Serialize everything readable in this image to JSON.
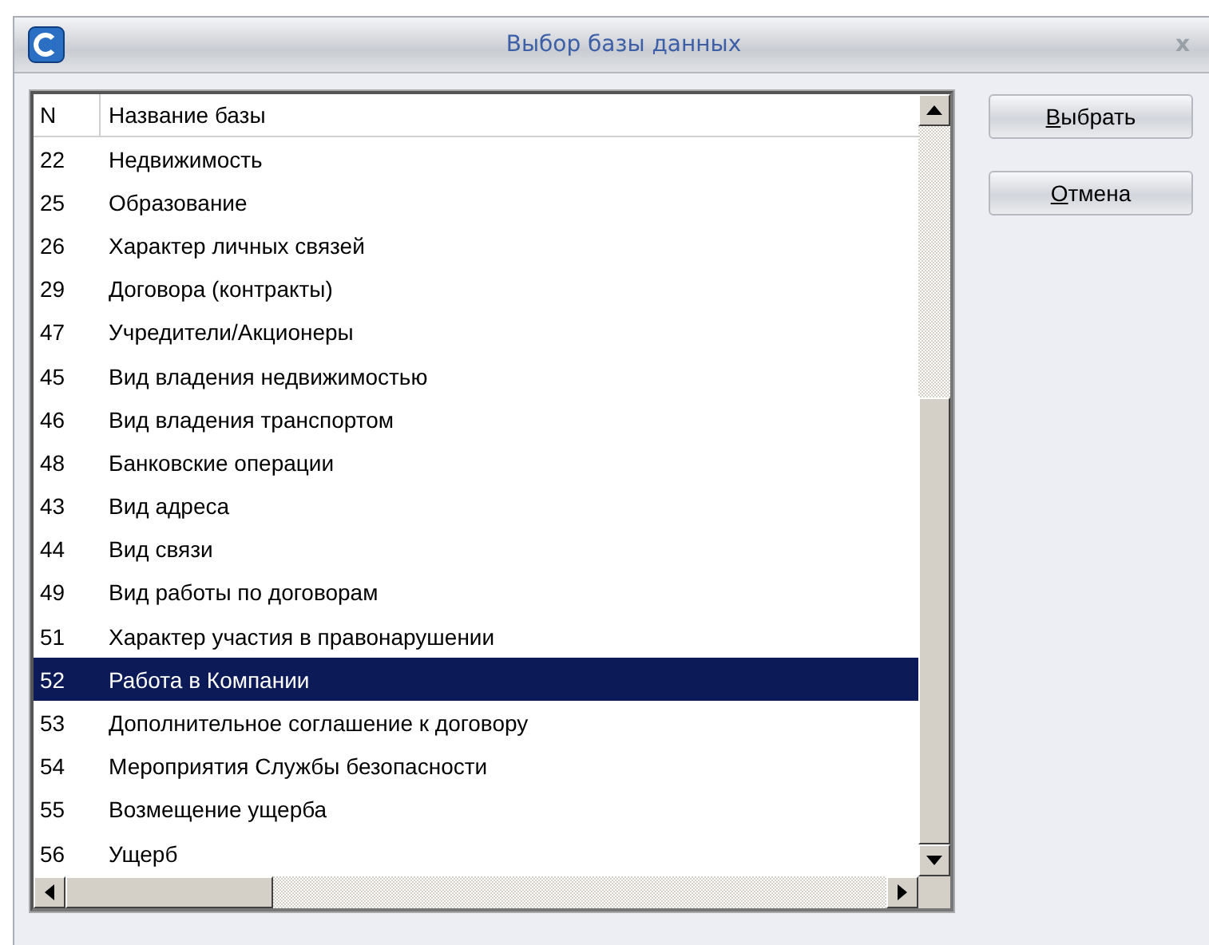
{
  "window": {
    "title": "Выбор базы данных",
    "close": "x"
  },
  "table": {
    "columns": [
      "N",
      "Название базы"
    ],
    "rows": [
      {
        "n": "22",
        "name": "Недвижимость",
        "selected": false
      },
      {
        "n": "25",
        "name": "Образование",
        "selected": false
      },
      {
        "n": "26",
        "name": "Характер личных связей",
        "selected": false
      },
      {
        "n": "29",
        "name": "Договора (контракты)",
        "selected": false
      },
      {
        "n": "47",
        "name": "Учредители/Акционеры",
        "selected": false
      },
      {
        "n": "45",
        "name": "Вид владения недвижимостью",
        "selected": false
      },
      {
        "n": "46",
        "name": "Вид владения транспортом",
        "selected": false
      },
      {
        "n": "48",
        "name": "Банковские операции",
        "selected": false
      },
      {
        "n": "43",
        "name": "Вид адреса",
        "selected": false
      },
      {
        "n": "44",
        "name": "Вид связи",
        "selected": false
      },
      {
        "n": "49",
        "name": "Вид работы по договорам",
        "selected": false
      },
      {
        "n": "51",
        "name": "Характер участия в правонарушении",
        "selected": false
      },
      {
        "n": "52",
        "name": "Работа в Компании",
        "selected": true
      },
      {
        "n": "53",
        "name": "Дополнительное соглашение к договору",
        "selected": false
      },
      {
        "n": "54",
        "name": "Мероприятия Службы безопасности",
        "selected": false
      },
      {
        "n": "55",
        "name": "Возмещение ущерба",
        "selected": false
      },
      {
        "n": "56",
        "name": "Ущерб",
        "selected": false
      }
    ]
  },
  "buttons": [
    "Выбрать",
    "Отмена"
  ]
}
